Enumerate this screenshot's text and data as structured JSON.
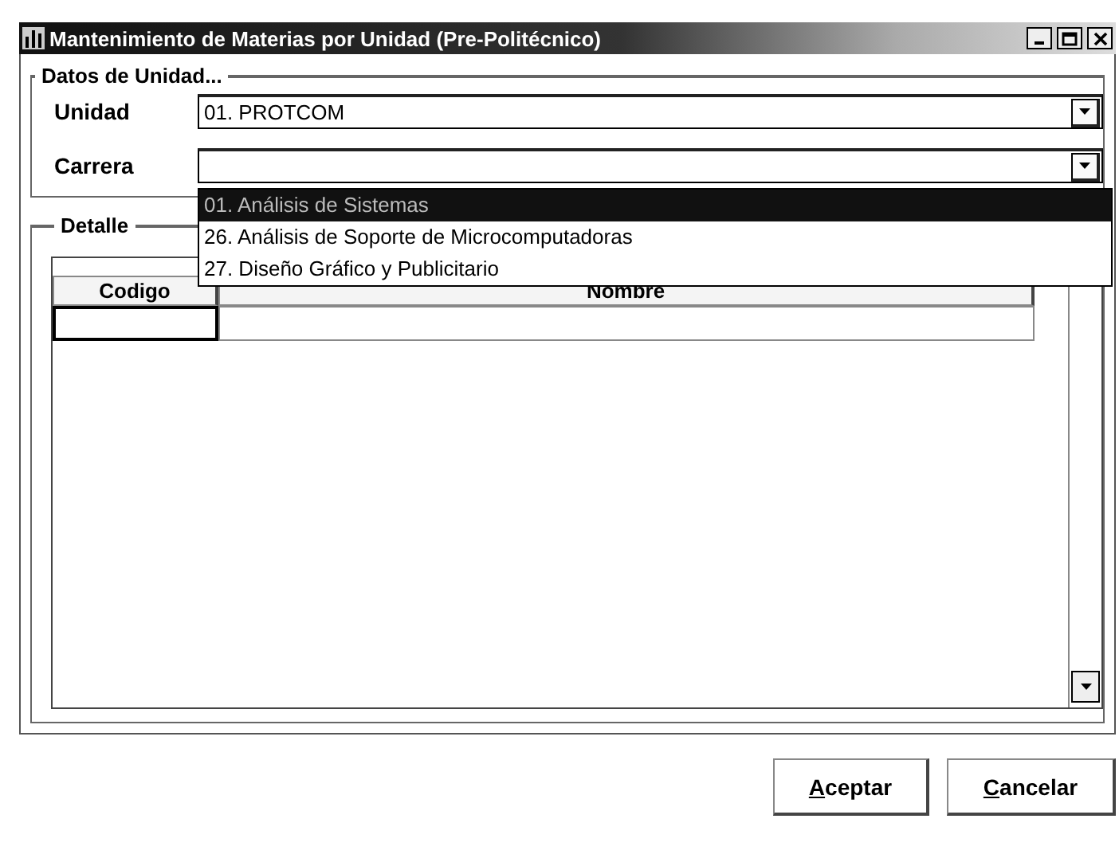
{
  "window": {
    "title": "Mantenimiento de Materias por Unidad (Pre-Politécnico)"
  },
  "datos": {
    "legend": "Datos de Unidad...",
    "fields": [
      {
        "label": "Unidad",
        "value": "01. PROTCOM"
      },
      {
        "label": "Carrera",
        "expanded": true,
        "options": [
          {
            "label": "01. Análisis de Sistemas",
            "selected": true
          },
          {
            "label": "26. Análisis de Soporte de Microcomputadoras",
            "selected": false
          },
          {
            "label": "27. Diseño Gráfico y Publicitario",
            "selected": false
          }
        ]
      }
    ]
  },
  "detalle": {
    "legend": "Detalle",
    "table": {
      "columns": [
        "Codigo",
        "Nombre"
      ]
    }
  },
  "buttons": [
    {
      "label": "Aceptar"
    },
    {
      "label": "Cancelar"
    }
  ]
}
